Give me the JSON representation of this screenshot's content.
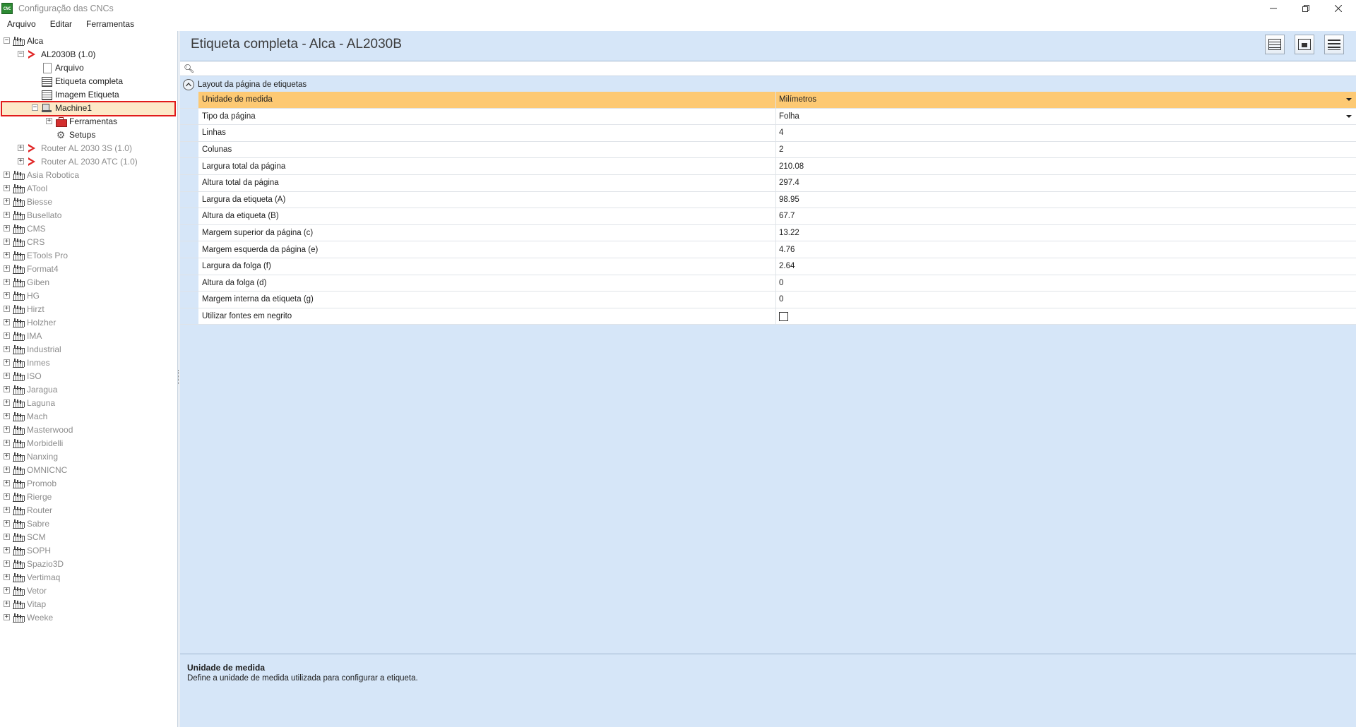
{
  "window": {
    "title": "Configuração das CNCs",
    "app_icon_text": "CNC"
  },
  "menu": [
    "Arquivo",
    "Editar",
    "Ferramentas"
  ],
  "tree": [
    {
      "label": "Alca",
      "level": 0,
      "expander": "−",
      "icon": "factory-icon",
      "gray": false
    },
    {
      "label": "AL2030B (1.0)",
      "level": 1,
      "expander": "−",
      "icon": "chevron-icon",
      "gray": false
    },
    {
      "label": "Arquivo",
      "level": 2,
      "expander": "",
      "icon": "doc-icon",
      "gray": false
    },
    {
      "label": "Etiqueta completa",
      "level": 2,
      "expander": "",
      "icon": "form-icon",
      "gray": false
    },
    {
      "label": "Imagem Etiqueta",
      "level": 2,
      "expander": "",
      "icon": "form-icon",
      "gray": false
    },
    {
      "label": "Machine1",
      "level": 2,
      "expander": "−",
      "icon": "machine-icon",
      "gray": false
    },
    {
      "label": "Ferramentas",
      "level": 3,
      "expander": "+",
      "icon": "toolbox-icon",
      "gray": false
    },
    {
      "label": "Setups",
      "level": 3,
      "expander": "",
      "icon": "gear-icon",
      "gray": false
    },
    {
      "label": "Router AL 2030 3S (1.0)",
      "level": 1,
      "expander": "+",
      "icon": "chevron-icon",
      "gray": true
    },
    {
      "label": "Router AL 2030 ATC (1.0)",
      "level": 1,
      "expander": "+",
      "icon": "chevron-icon",
      "gray": true
    },
    {
      "label": "Asia Robotica",
      "level": 0,
      "expander": "+",
      "icon": "factory-icon",
      "gray": true
    },
    {
      "label": "ATool",
      "level": 0,
      "expander": "+",
      "icon": "factory-icon",
      "gray": true
    },
    {
      "label": "Biesse",
      "level": 0,
      "expander": "+",
      "icon": "factory-icon",
      "gray": true
    },
    {
      "label": "Busellato",
      "level": 0,
      "expander": "+",
      "icon": "factory-icon",
      "gray": true
    },
    {
      "label": "CMS",
      "level": 0,
      "expander": "+",
      "icon": "factory-icon",
      "gray": true
    },
    {
      "label": "CRS",
      "level": 0,
      "expander": "+",
      "icon": "factory-icon",
      "gray": true
    },
    {
      "label": "ETools Pro",
      "level": 0,
      "expander": "+",
      "icon": "factory-icon",
      "gray": true
    },
    {
      "label": "Format4",
      "level": 0,
      "expander": "+",
      "icon": "factory-icon",
      "gray": true
    },
    {
      "label": "Giben",
      "level": 0,
      "expander": "+",
      "icon": "factory-icon",
      "gray": true
    },
    {
      "label": "HG",
      "level": 0,
      "expander": "+",
      "icon": "factory-icon",
      "gray": true
    },
    {
      "label": "Hirzt",
      "level": 0,
      "expander": "+",
      "icon": "factory-icon",
      "gray": true
    },
    {
      "label": "Holzher",
      "level": 0,
      "expander": "+",
      "icon": "factory-icon",
      "gray": true
    },
    {
      "label": "IMA",
      "level": 0,
      "expander": "+",
      "icon": "factory-icon",
      "gray": true
    },
    {
      "label": "Industrial",
      "level": 0,
      "expander": "+",
      "icon": "factory-icon",
      "gray": true
    },
    {
      "label": "Inmes",
      "level": 0,
      "expander": "+",
      "icon": "factory-icon",
      "gray": true
    },
    {
      "label": "ISO",
      "level": 0,
      "expander": "+",
      "icon": "factory-icon",
      "gray": true
    },
    {
      "label": "Jaragua",
      "level": 0,
      "expander": "+",
      "icon": "factory-icon",
      "gray": true
    },
    {
      "label": "Laguna",
      "level": 0,
      "expander": "+",
      "icon": "factory-icon",
      "gray": true
    },
    {
      "label": "Mach",
      "level": 0,
      "expander": "+",
      "icon": "factory-icon",
      "gray": true
    },
    {
      "label": "Masterwood",
      "level": 0,
      "expander": "+",
      "icon": "factory-icon",
      "gray": true
    },
    {
      "label": "Morbidelli",
      "level": 0,
      "expander": "+",
      "icon": "factory-icon",
      "gray": true
    },
    {
      "label": "Nanxing",
      "level": 0,
      "expander": "+",
      "icon": "factory-icon",
      "gray": true
    },
    {
      "label": "OMNICNC",
      "level": 0,
      "expander": "+",
      "icon": "factory-icon",
      "gray": true
    },
    {
      "label": "Promob",
      "level": 0,
      "expander": "+",
      "icon": "factory-icon",
      "gray": true
    },
    {
      "label": "Rierge",
      "level": 0,
      "expander": "+",
      "icon": "factory-icon",
      "gray": true
    },
    {
      "label": "Router",
      "level": 0,
      "expander": "+",
      "icon": "factory-icon",
      "gray": true
    },
    {
      "label": "Sabre",
      "level": 0,
      "expander": "+",
      "icon": "factory-icon",
      "gray": true
    },
    {
      "label": "SCM",
      "level": 0,
      "expander": "+",
      "icon": "factory-icon",
      "gray": true
    },
    {
      "label": "SOPH",
      "level": 0,
      "expander": "+",
      "icon": "factory-icon",
      "gray": true
    },
    {
      "label": "Spazio3D",
      "level": 0,
      "expander": "+",
      "icon": "factory-icon",
      "gray": true
    },
    {
      "label": "Vertimaq",
      "level": 0,
      "expander": "+",
      "icon": "factory-icon",
      "gray": true
    },
    {
      "label": "Vetor",
      "level": 0,
      "expander": "+",
      "icon": "factory-icon",
      "gray": true
    },
    {
      "label": "Vitap",
      "level": 0,
      "expander": "+",
      "icon": "factory-icon",
      "gray": true
    },
    {
      "label": "Weeke",
      "level": 0,
      "expander": "+",
      "icon": "factory-icon",
      "gray": true
    }
  ],
  "selected_tree_label": "Etiqueta completa",
  "content": {
    "title": "Etiqueta completa - Alca - AL2030B",
    "search": {
      "value": "",
      "placeholder": ""
    },
    "category": "Layout da página de etiquetas",
    "properties": [
      {
        "name": "Unidade de medida",
        "value": "Milímetros",
        "dropdown": true,
        "selected": true
      },
      {
        "name": "Tipo da página",
        "value": "Folha",
        "dropdown": true
      },
      {
        "name": "Linhas",
        "value": "4"
      },
      {
        "name": "Colunas",
        "value": "2"
      },
      {
        "name": "Largura total da página",
        "value": "210.08"
      },
      {
        "name": "Altura total da página",
        "value": "297.4"
      },
      {
        "name": "Largura da etiqueta (A)",
        "value": "98.95"
      },
      {
        "name": "Altura da etiqueta (B)",
        "value": "67.7"
      },
      {
        "name": "Margem superior da página (c)",
        "value": "13.22"
      },
      {
        "name": "Margem esquerda da página (e)",
        "value": "4.76"
      },
      {
        "name": "Largura da folga (f)",
        "value": "2.64"
      },
      {
        "name": "Altura da folga (d)",
        "value": "0"
      },
      {
        "name": "Margem interna da etiqueta (g)",
        "value": "0"
      },
      {
        "name": "Utilizar fontes em negrito",
        "value": "",
        "checkbox": true,
        "checked": false
      }
    ],
    "description": {
      "title": "Unidade de medida",
      "text": "Define a unidade de medida utilizada para configurar a etiqueta."
    }
  },
  "colors": {
    "content_bg": "#d6e6f8",
    "selected_row": "#fdc973",
    "highlight_border": "#e11b1b",
    "chevron_red": "#e02424"
  }
}
